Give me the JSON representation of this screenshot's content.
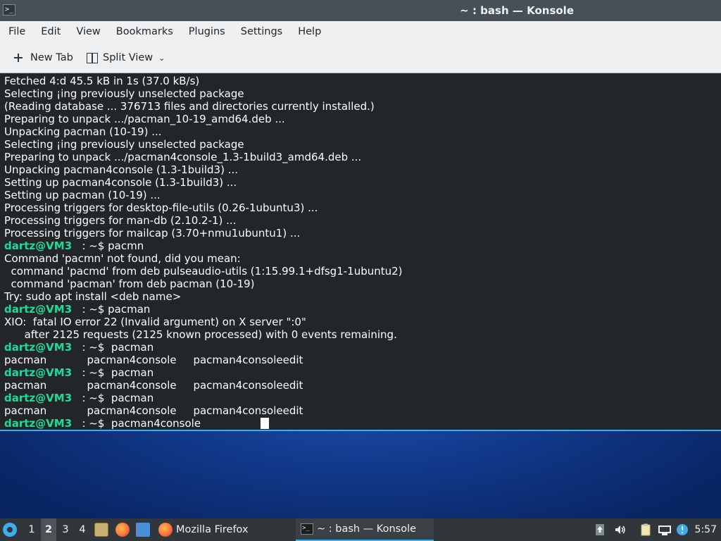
{
  "window": {
    "title": "~ : bash — Konsole",
    "app_icon_glyph": ">_"
  },
  "menubar": {
    "items": [
      "File",
      "Edit",
      "View",
      "Bookmarks",
      "Plugins",
      "Settings",
      "Help"
    ]
  },
  "toolbar": {
    "new_tab_label": "New Tab",
    "split_view_label": "Split View"
  },
  "terminal": {
    "prompt_user": "dartz@VM3",
    "prompt_path": ": ~$",
    "lines": [
      {
        "type": "text",
        "text": "Fetched 4:d 45.5 kB in 1s (37.0 kB/s)"
      },
      {
        "type": "text",
        "text": "Selecting ¡ing previously unselected package"
      },
      {
        "type": "text",
        "text": "(Reading database ... 376713 files and directories currently installed.)"
      },
      {
        "type": "text",
        "text": "Preparing to unpack .../pacman_10-19_amd64.deb ..."
      },
      {
        "type": "text",
        "text": "Unpacking pacman (10-19) ..."
      },
      {
        "type": "text",
        "text": "Selecting ¡ing previously unselected package"
      },
      {
        "type": "text",
        "text": "Preparing to unpack .../pacman4console_1.3-1build3_amd64.deb ..."
      },
      {
        "type": "text",
        "text": "Unpacking pacman4console (1.3-1build3) ..."
      },
      {
        "type": "text",
        "text": "Setting up pacman4console (1.3-1build3) ..."
      },
      {
        "type": "text",
        "text": "Setting up pacman (10-19) ..."
      },
      {
        "type": "text",
        "text": "Processing triggers for desktop-file-utils (0.26-1ubuntu3) ..."
      },
      {
        "type": "text",
        "text": "Processing triggers for man-db (2.10.2-1) ..."
      },
      {
        "type": "text",
        "text": "Processing triggers for mailcap (3.70+nmu1ubuntu1) ..."
      },
      {
        "type": "prompt",
        "text": " pacmn"
      },
      {
        "type": "text",
        "text": "Command 'pacmn' not found, did you mean:"
      },
      {
        "type": "text",
        "text": "  command 'pacmd' from deb pulseaudio-utils (1:15.99.1+dfsg1-1ubuntu2)"
      },
      {
        "type": "text",
        "text": "  command 'pacman' from deb pacman (10-19)"
      },
      {
        "type": "text",
        "text": "Try: sudo apt install <deb name>"
      },
      {
        "type": "prompt",
        "text": " pacman"
      },
      {
        "type": "text",
        "text": "XIO:  fatal IO error 22 (Invalid argument) on X server \":0\""
      },
      {
        "type": "text",
        "text": "      after 2125 requests (2125 known processed) with 0 events remaining."
      },
      {
        "type": "prompt",
        "text": "  pacman"
      },
      {
        "type": "text",
        "text": "pacman            pacman4console     pacman4consoleedit"
      },
      {
        "type": "prompt",
        "text": "  pacman"
      },
      {
        "type": "text",
        "text": "pacman            pacman4console     pacman4consoleedit"
      },
      {
        "type": "prompt",
        "text": "  pacman"
      },
      {
        "type": "text",
        "text": "pacman            pacman4console     pacman4consoleedit"
      },
      {
        "type": "prompt",
        "text": "  pacman4console"
      }
    ]
  },
  "taskbar": {
    "desktops": [
      "1",
      "2",
      "3",
      "4"
    ],
    "active_desktop": "2",
    "tasks": {
      "firefox_label": "Mozilla Firefox",
      "konsole_label": "~ : bash — Konsole"
    },
    "launchers": [
      "application-launcher-icon",
      "files-icon",
      "firefox-icon",
      "folder-icon"
    ],
    "tray_icons": [
      "updates-icon",
      "volume-icon",
      "clipboard-icon",
      "network-icon",
      "notifications-icon"
    ],
    "clock": "5:57"
  },
  "colors": {
    "accent": "#3daee9",
    "prompt_user": "#1cdc9a",
    "terminal_bg": "#232629",
    "panel_bg": "#31363b"
  }
}
